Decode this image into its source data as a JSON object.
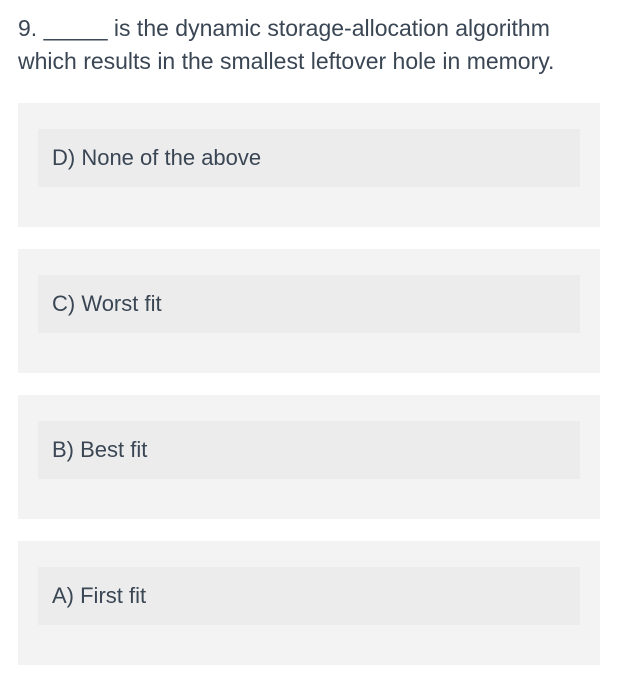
{
  "question": {
    "number": "9.",
    "text": "_____ is the dynamic storage-allocation algorithm which results in the smallest leftover hole in memory."
  },
  "options": [
    {
      "label": "D) None of the above"
    },
    {
      "label": "C) Worst fit"
    },
    {
      "label": "B) Best fit"
    },
    {
      "label": "A) First fit"
    }
  ]
}
